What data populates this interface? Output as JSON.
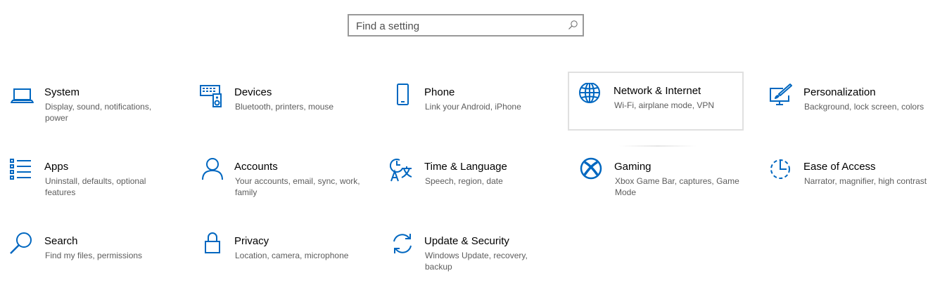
{
  "search": {
    "placeholder": "Find a setting"
  },
  "accent_color": "#0067c0",
  "tiles": [
    {
      "title": "System",
      "description": "Display, sound, notifications, power",
      "icon": "laptop-icon"
    },
    {
      "title": "Devices",
      "description": "Bluetooth, printers, mouse",
      "icon": "keyboard-speaker-icon"
    },
    {
      "title": "Phone",
      "description": "Link your Android, iPhone",
      "icon": "phone-icon"
    },
    {
      "title": "Network & Internet",
      "description": "Wi-Fi, airplane mode, VPN",
      "icon": "globe-icon"
    },
    {
      "title": "Personalization",
      "description": "Background, lock screen, colors",
      "icon": "paintbrush-monitor-icon"
    },
    {
      "title": "Apps",
      "description": "Uninstall, defaults, optional features",
      "icon": "apps-list-icon"
    },
    {
      "title": "Accounts",
      "description": "Your accounts, email, sync, work, family",
      "icon": "person-icon"
    },
    {
      "title": "Time & Language",
      "description": "Speech, region, date",
      "icon": "time-language-icon"
    },
    {
      "title": "Gaming",
      "description": "Xbox Game Bar, captures, Game Mode",
      "icon": "xbox-icon"
    },
    {
      "title": "Ease of Access",
      "description": "Narrator, magnifier, high contrast",
      "icon": "ease-of-access-icon"
    },
    {
      "title": "Search",
      "description": "Find my files, permissions",
      "icon": "magnifier-icon"
    },
    {
      "title": "Privacy",
      "description": "Location, camera, microphone",
      "icon": "padlock-icon"
    },
    {
      "title": "Update & Security",
      "description": "Windows Update, recovery, backup",
      "icon": "sync-arrows-icon"
    }
  ]
}
